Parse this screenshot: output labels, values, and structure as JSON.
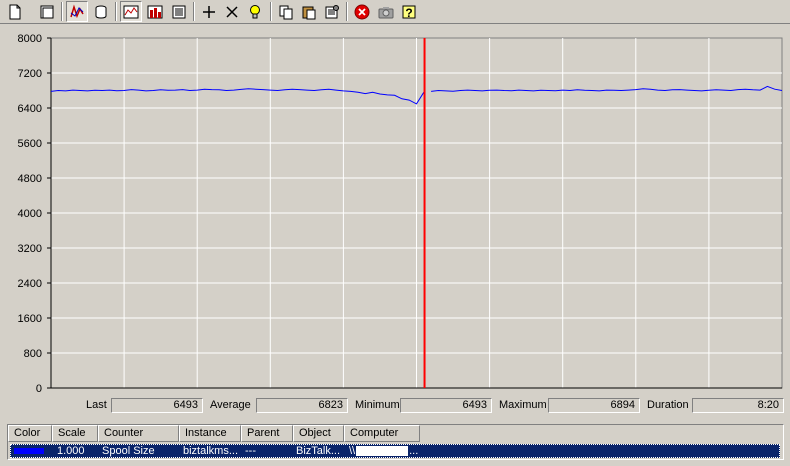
{
  "toolbar": {
    "buttons": [
      {
        "name": "new-counter-set-icon",
        "pressed": false
      },
      {
        "name": "clear-display-icon",
        "pressed": false
      },
      {
        "name": "view-current-activity-icon",
        "pressed": true
      },
      {
        "name": "view-log-data-icon",
        "pressed": false
      },
      {
        "name": "view-graph-icon",
        "pressed": true
      },
      {
        "name": "view-histogram-icon",
        "pressed": false
      },
      {
        "name": "view-report-icon",
        "pressed": false
      },
      {
        "name": "add-counter-icon",
        "pressed": false
      },
      {
        "name": "delete-counter-icon",
        "pressed": false
      },
      {
        "name": "highlight-icon",
        "pressed": false
      },
      {
        "name": "copy-properties-icon",
        "pressed": false
      },
      {
        "name": "paste-counter-list-icon",
        "pressed": false
      },
      {
        "name": "properties-icon",
        "pressed": false
      },
      {
        "name": "freeze-display-icon",
        "pressed": false
      },
      {
        "name": "update-data-icon",
        "pressed": false
      },
      {
        "name": "help-icon",
        "pressed": false
      }
    ]
  },
  "chart_data": {
    "type": "line",
    "ylim": [
      0,
      8000
    ],
    "yticks": [
      "8000",
      "7200",
      "6400",
      "5600",
      "4800",
      "4000",
      "3200",
      "2400",
      "1600",
      "800",
      "0"
    ],
    "grid": true,
    "background": "#d4d0c8",
    "plot_background": "#d4d0c8",
    "line_color": "#0000ff",
    "cursor_color": "#ff0000",
    "cursor_fraction": 0.511,
    "series": [
      {
        "values": [
          6780,
          6800,
          6790,
          6810,
          6800,
          6790,
          6805,
          6800,
          6810,
          6795,
          6800,
          6820,
          6810,
          6790,
          6800,
          6815,
          6805,
          6810,
          6820,
          6800,
          6810,
          6830,
          6820,
          6815,
          6800,
          6810,
          6825,
          6840,
          6830,
          6820,
          6810,
          6800,
          6815,
          6830,
          6820,
          6810,
          6800,
          6815,
          6830,
          6810,
          6790,
          6780,
          6760,
          6730,
          6760,
          6720,
          6700,
          6690,
          6610,
          6580,
          6493,
          6760,
          6780,
          6800,
          6790,
          6785,
          6800,
          6810,
          6800,
          6790,
          6805,
          6810,
          6800,
          6795,
          6810,
          6800,
          6790,
          6805,
          6800,
          6795,
          6810,
          6800,
          6815,
          6805,
          6800,
          6790,
          6810,
          6805,
          6800,
          6810,
          6820,
          6840,
          6830,
          6810,
          6800,
          6815,
          6820,
          6810,
          6800,
          6790,
          6805,
          6815,
          6810,
          6800,
          6820,
          6830,
          6815,
          6810,
          6894,
          6830,
          6800
        ]
      }
    ]
  },
  "valuebar": {
    "last_label": "Last",
    "last_value": "6493",
    "average_label": "Average",
    "average_value": "6823",
    "minimum_label": "Minimum",
    "minimum_value": "6493",
    "maximum_label": "Maximum",
    "maximum_value": "6894",
    "duration_label": "Duration",
    "duration_value": "8:20"
  },
  "legend": {
    "headers": [
      "Color",
      "Scale",
      "Counter",
      "Instance",
      "Parent",
      "Object",
      "Computer"
    ],
    "row": {
      "scale": "1.000",
      "counter": "Spool Size",
      "instance": "biztalkms...",
      "parent": "---",
      "object": "BizTalk...",
      "computer_prefix": "\\\\",
      "computer_suffix": "..."
    }
  }
}
